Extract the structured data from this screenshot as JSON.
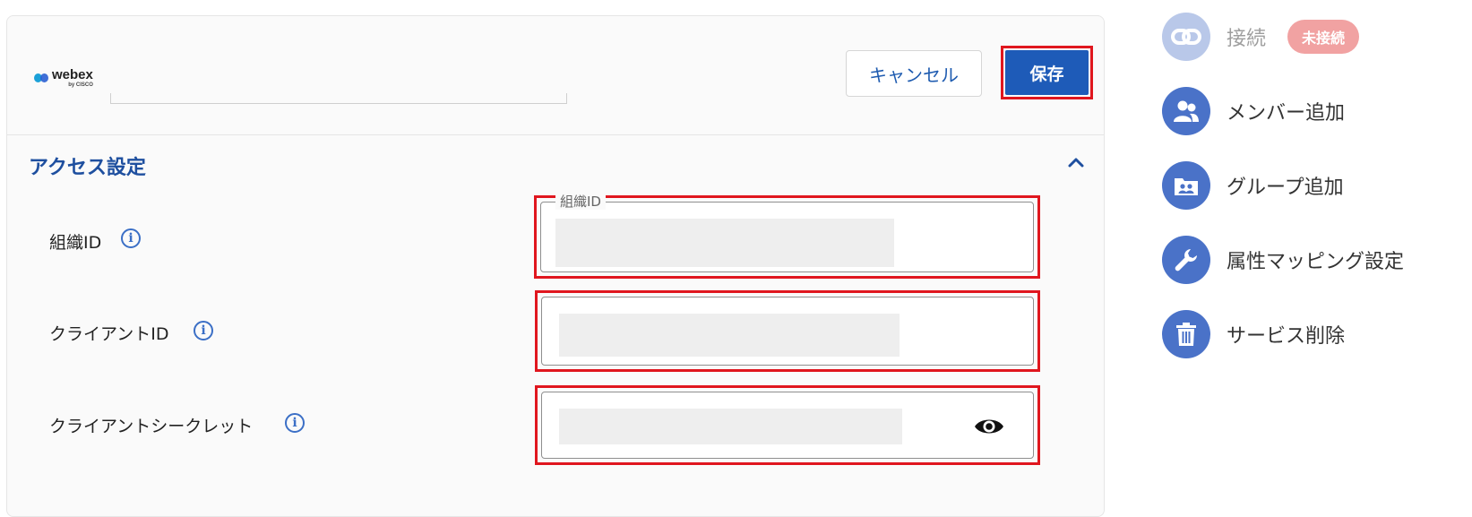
{
  "header": {
    "logo_word": "webex",
    "logo_sub": "by CISCO",
    "cancel_label": "キャンセル",
    "save_label": "保存"
  },
  "access": {
    "title": "アクセス設定",
    "org_id": {
      "label": "組織ID",
      "legend": "組織ID"
    },
    "client_id": {
      "label": "クライアントID"
    },
    "client_secret": {
      "label": "クライアントシークレット"
    }
  },
  "side": {
    "connect": {
      "label": "接続",
      "badge": "未接続"
    },
    "add_member": {
      "label": "メンバー追加"
    },
    "add_group": {
      "label": "グループ追加"
    },
    "attr_mapping": {
      "label": "属性マッピング設定"
    },
    "delete_service": {
      "label": "サービス削除"
    }
  },
  "icons": {
    "info": "info-icon",
    "eye": "eye-icon",
    "chevron": "chevron-up-icon",
    "connect": "link-icon",
    "member": "people-icon",
    "group": "group-folder-icon",
    "mapping": "wrench-icon",
    "delete": "trash-icon"
  },
  "colors": {
    "accent": "#1e5bb8",
    "highlight": "#e0161e",
    "side_icon": "#4a72c8",
    "badge": "#f1a2a2"
  }
}
